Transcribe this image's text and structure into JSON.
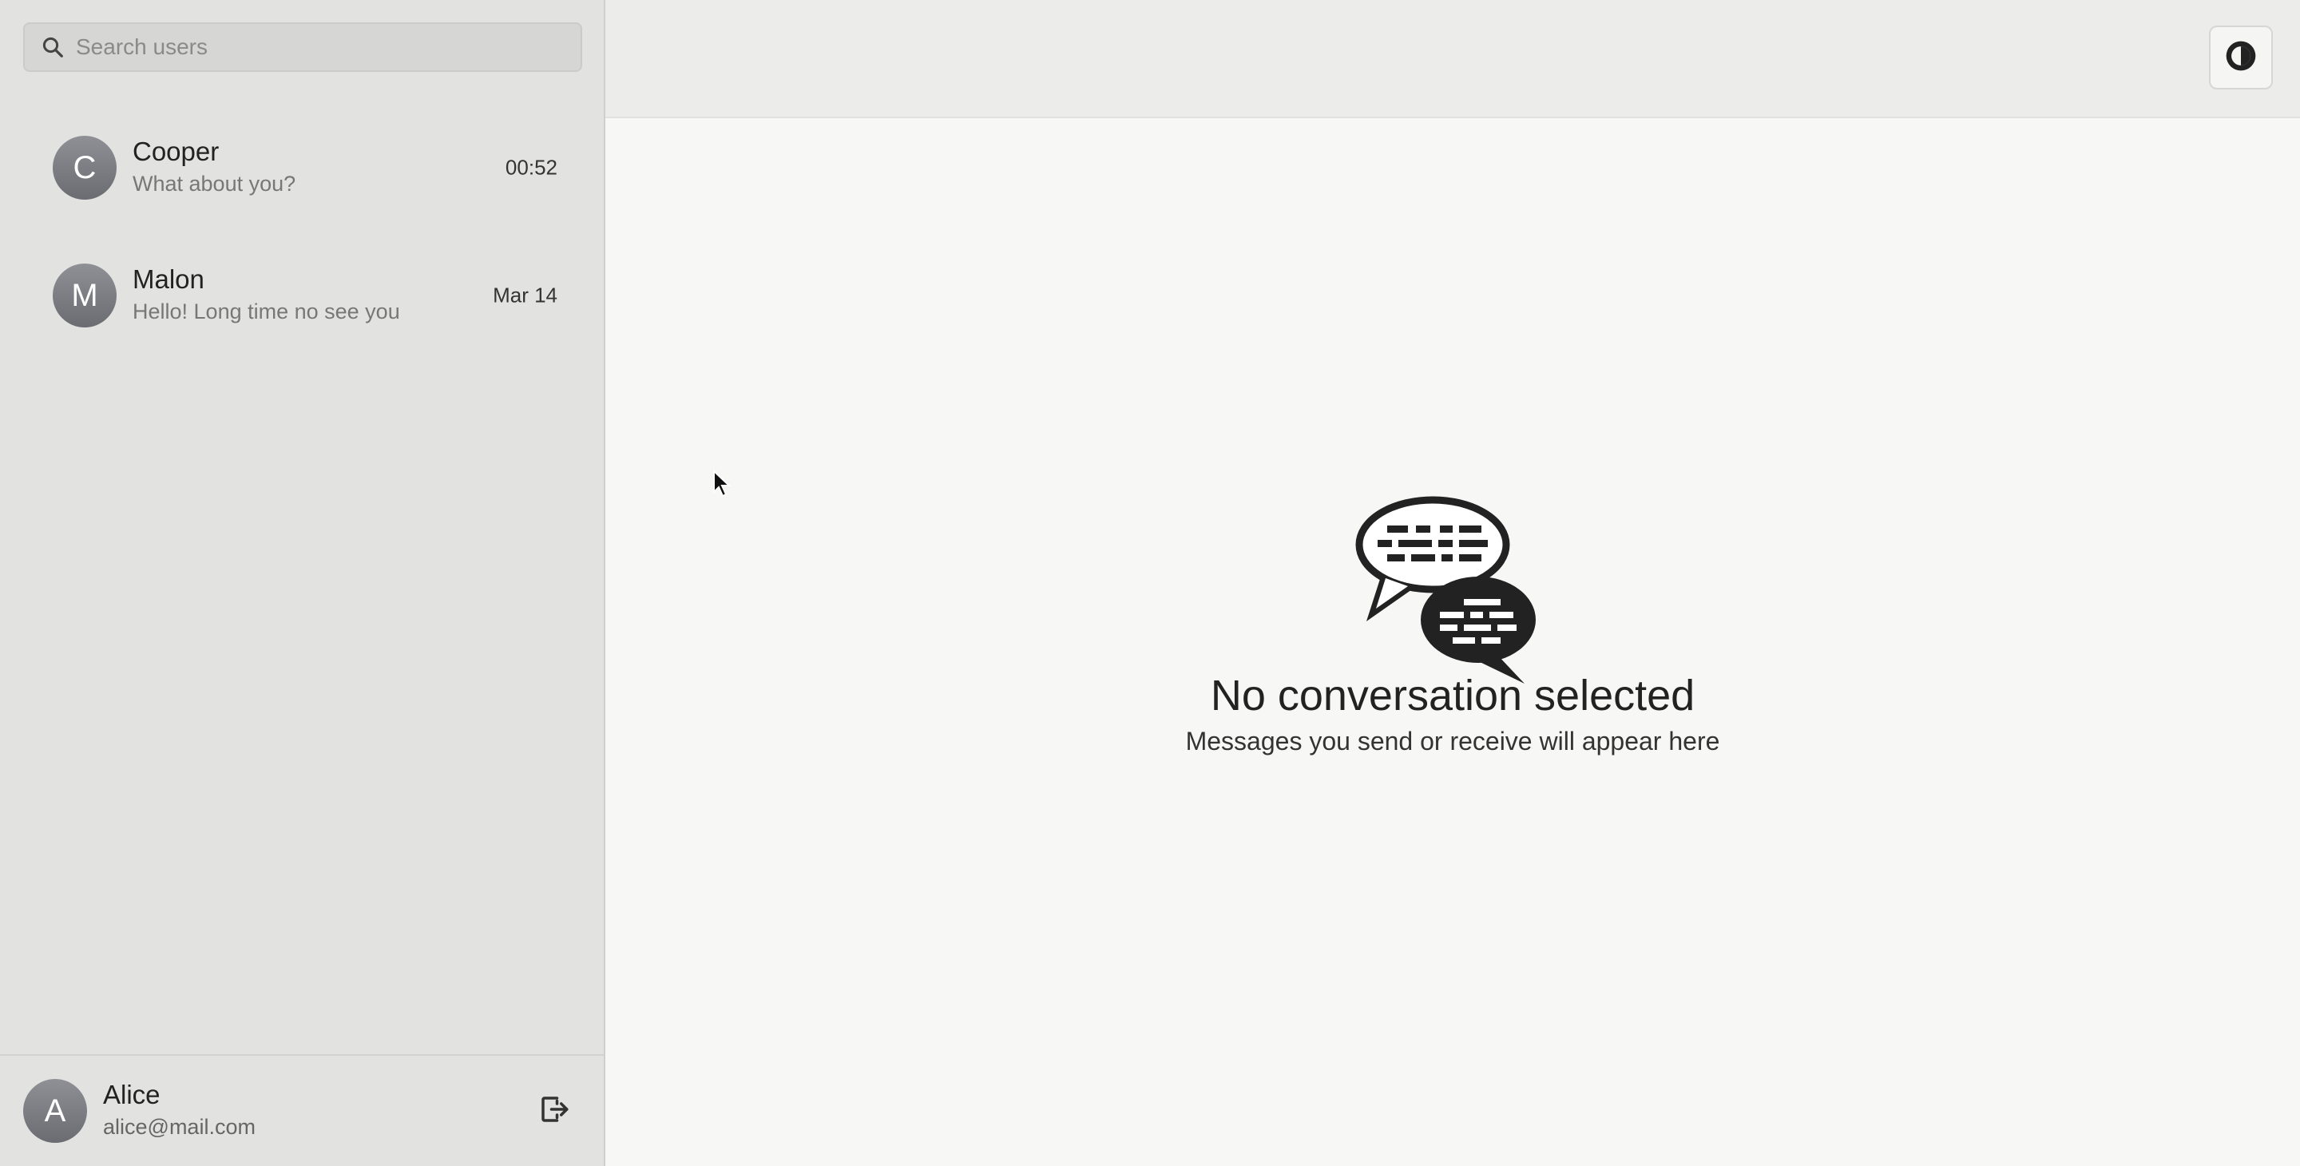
{
  "search": {
    "placeholder": "Search users"
  },
  "conversations": [
    {
      "initial": "C",
      "name": "Cooper",
      "preview": "What about you?",
      "time": "00:52"
    },
    {
      "initial": "M",
      "name": "Malon",
      "preview": "Hello! Long time no see you",
      "time": "Mar 14"
    }
  ],
  "current_user": {
    "initial": "A",
    "name": "Alice",
    "email": "alice@mail.com"
  },
  "empty_state": {
    "title": "No conversation selected",
    "subtitle": "Messages you send or receive will appear here"
  },
  "icons": {
    "search": "search-icon",
    "logout": "logout-icon",
    "theme_toggle": "theme-toggle-icon",
    "empty_state": "chat-bubbles-icon"
  },
  "colors": {
    "sidebar_bg": "#e2e2e1",
    "main_bg": "#f7f7f6",
    "avatar_bg": "#7c7d83",
    "text_primary": "#222222"
  }
}
